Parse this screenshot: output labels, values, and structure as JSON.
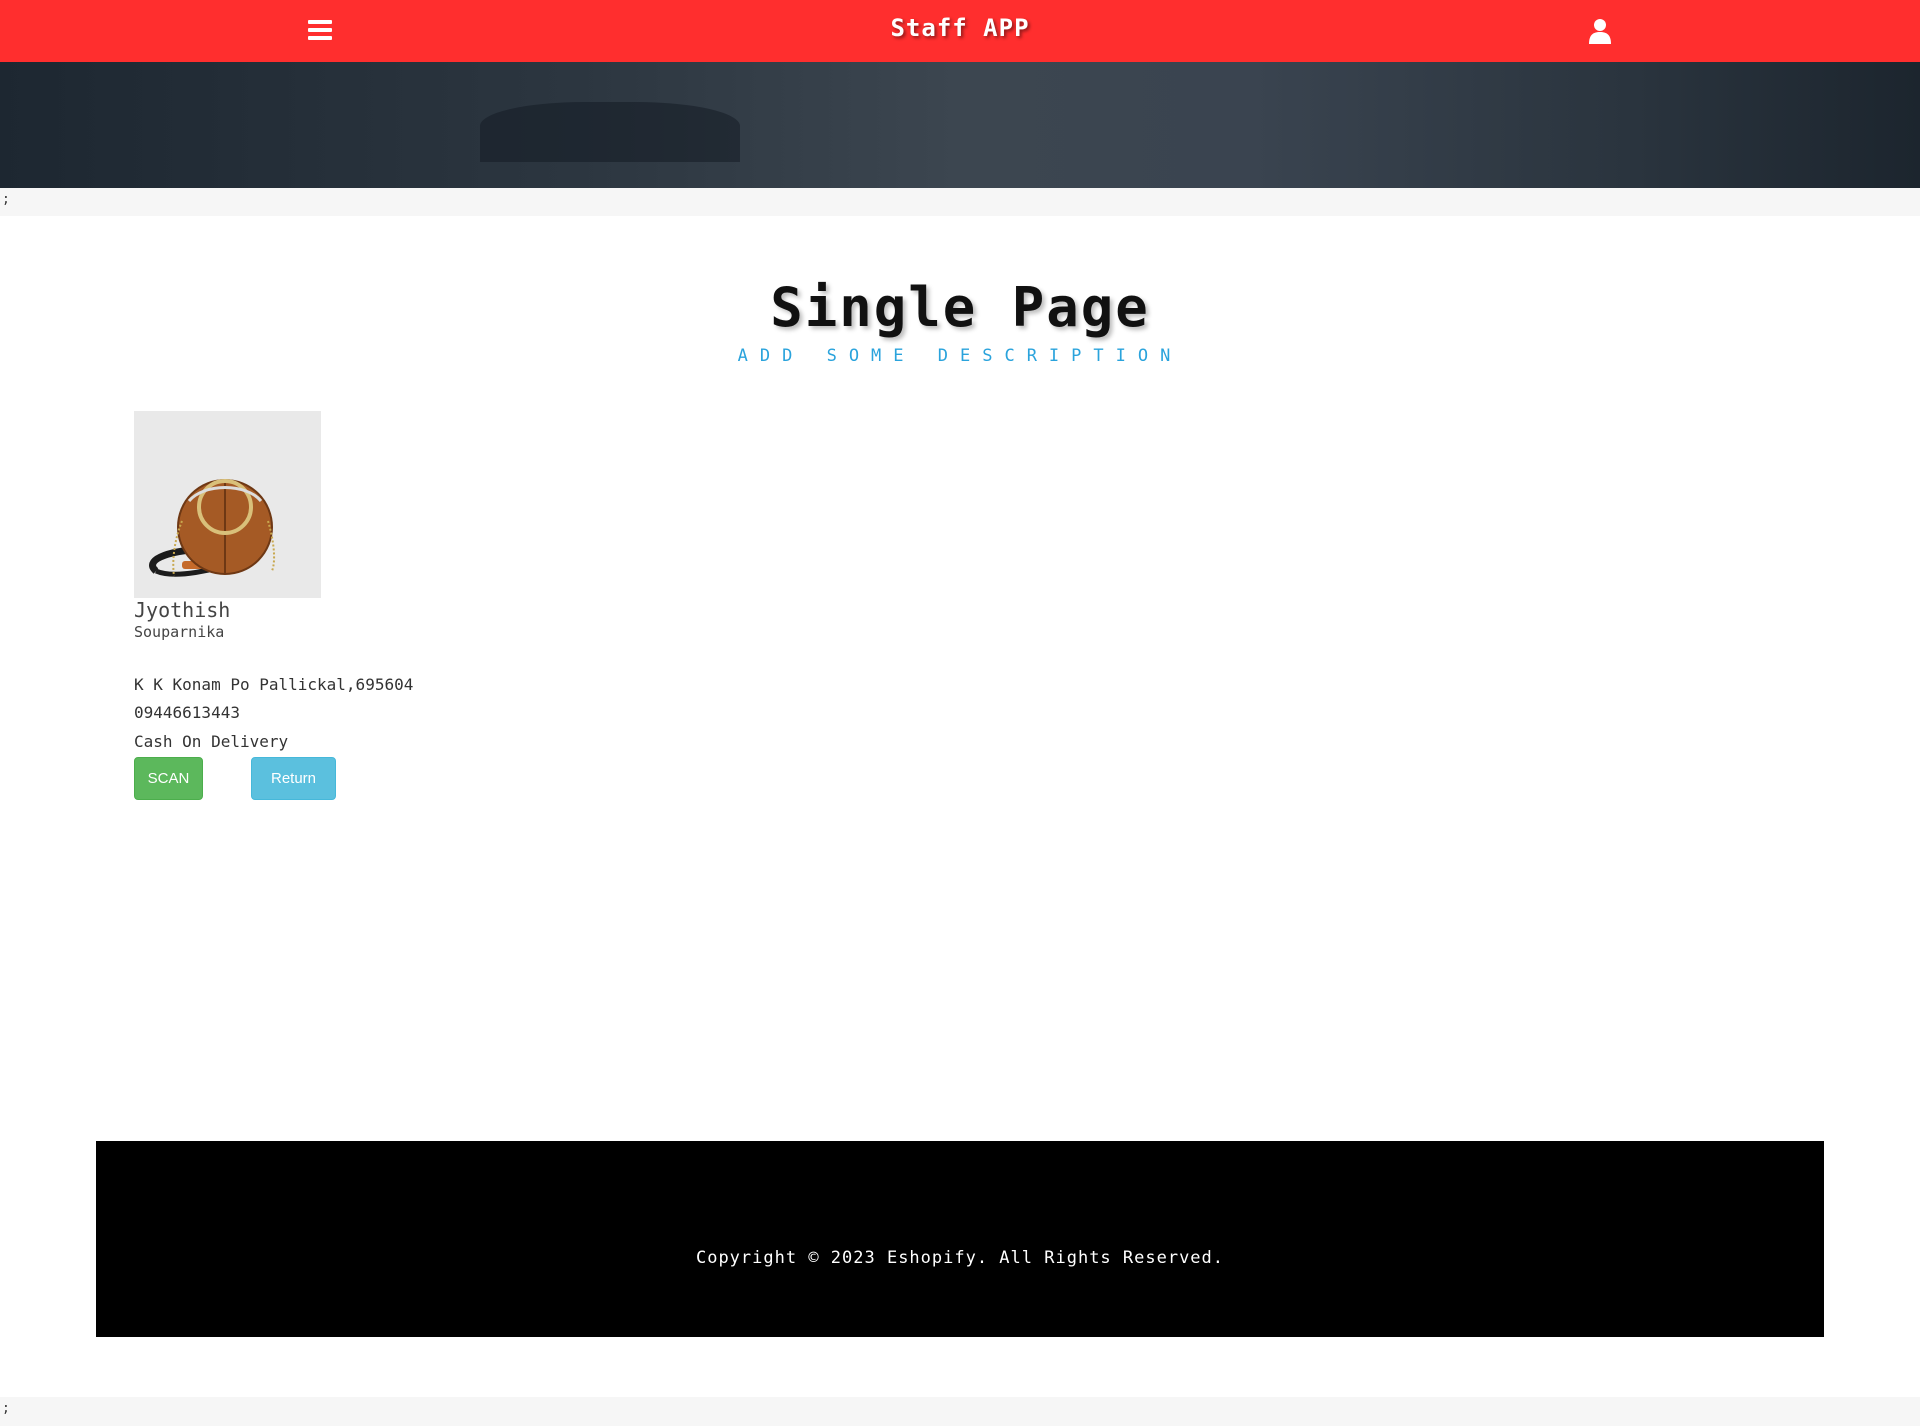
{
  "header": {
    "title": "Staff APP",
    "menu_icon": "menu-icon",
    "user_icon": "user-icon",
    "background_color": "#ff2e2e"
  },
  "stray_text": ";",
  "page": {
    "title": "Single Page",
    "description": "ADD SOME DESCRIPTION"
  },
  "order": {
    "customer_name": "Jyothish",
    "house_name": "Souparnika",
    "address": "K K Konam Po Pallickal,695604",
    "phone": "09446613443",
    "payment_method": "Cash On Delivery",
    "scan_label": "SCAN",
    "return_label": "Return"
  },
  "footer": {
    "copyright": "Copyright © 2023 Eshopify. All Rights Reserved."
  },
  "colors": {
    "scan_button": "#5cb85c",
    "return_button": "#5bc0de",
    "description": "#2aa3dc",
    "footer_bg": "#000000"
  }
}
